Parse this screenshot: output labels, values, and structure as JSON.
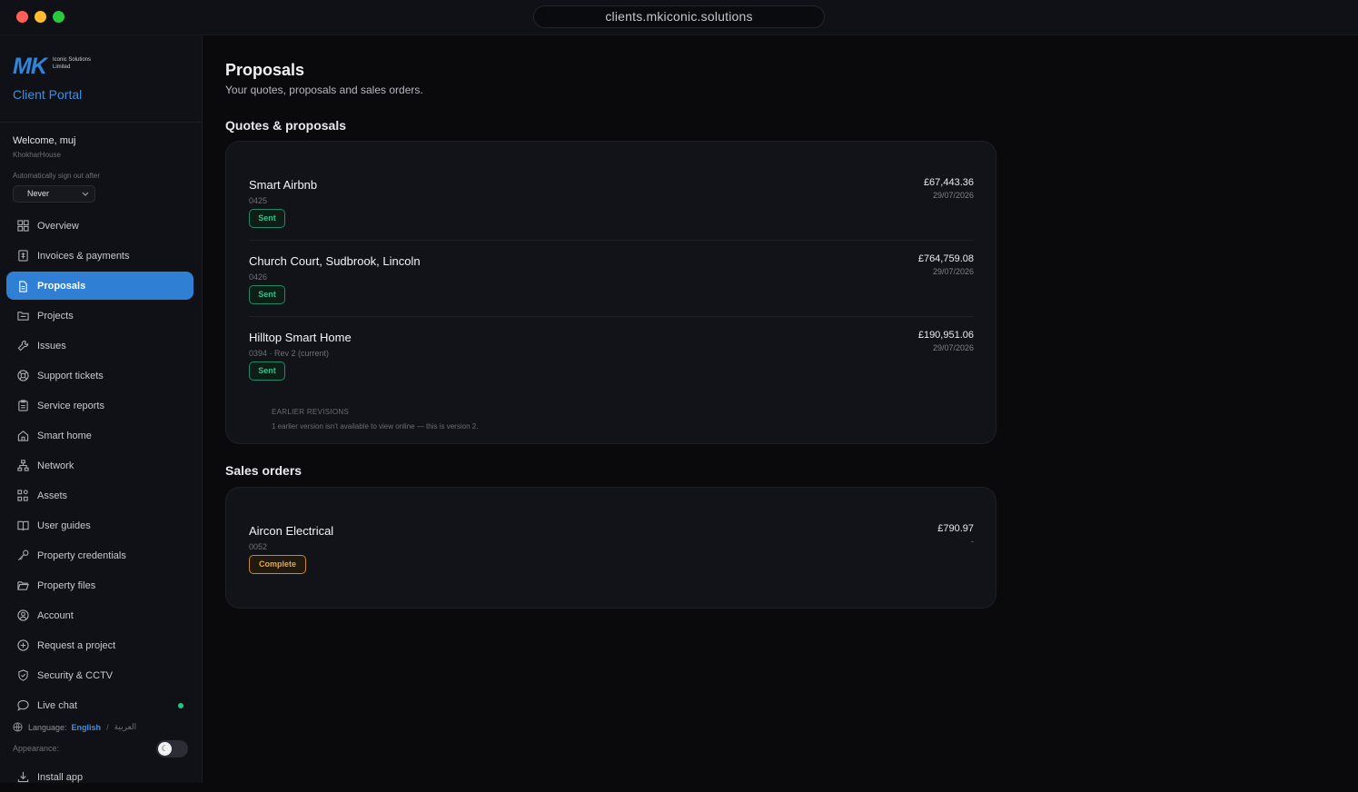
{
  "browser": {
    "url": "clients.mkiconic.solutions"
  },
  "brand": {
    "logo_text": "MK",
    "logo_subtext": "Iconic Solutions Limited",
    "portal_label": "Client Portal"
  },
  "user": {
    "welcome": "Welcome, muj",
    "company": "KhokharHouse"
  },
  "signout": {
    "label": "Automatically sign out after",
    "value": "Never"
  },
  "nav": {
    "items": [
      {
        "label": "Overview",
        "icon": "grid-icon"
      },
      {
        "label": "Invoices & payments",
        "icon": "receipt-icon"
      },
      {
        "label": "Proposals",
        "icon": "document-icon",
        "active": true
      },
      {
        "label": "Projects",
        "icon": "folder-icon"
      },
      {
        "label": "Issues",
        "icon": "wrench-icon"
      },
      {
        "label": "Support tickets",
        "icon": "lifebuoy-icon"
      },
      {
        "label": "Service reports",
        "icon": "clipboard-icon"
      },
      {
        "label": "Smart home",
        "icon": "home-icon"
      },
      {
        "label": "Network",
        "icon": "network-icon"
      },
      {
        "label": "Assets",
        "icon": "assets-icon"
      },
      {
        "label": "User guides",
        "icon": "book-icon"
      },
      {
        "label": "Property credentials",
        "icon": "key-icon"
      },
      {
        "label": "Property files",
        "icon": "folder-open-icon"
      },
      {
        "label": "Account",
        "icon": "user-circle-icon"
      },
      {
        "label": "Request a project",
        "icon": "plus-circle-icon"
      },
      {
        "label": "Security & CCTV",
        "icon": "shield-icon"
      },
      {
        "label": "Live chat",
        "icon": "chat-icon"
      }
    ],
    "install_label": "Install app"
  },
  "language": {
    "label": "Language:",
    "current": "English",
    "alternate": "العربية"
  },
  "appearance": {
    "label": "Appearance:"
  },
  "colors": {
    "accent": "#2f7fd5",
    "sent": "#2cc48c",
    "complete": "#e8a540",
    "online": "#23c48a"
  },
  "page": {
    "title": "Proposals",
    "subtitle": "Your quotes, proposals and sales orders."
  },
  "quotes": {
    "section_title": "Quotes & proposals",
    "items": [
      {
        "title": "Smart Airbnb",
        "ref": "0425",
        "status": "Sent",
        "amount": "£67,443.36",
        "date": "29/07/2026"
      },
      {
        "title": "Church Court, Sudbrook, Lincoln",
        "ref": "0426",
        "status": "Sent",
        "amount": "£764,759.08",
        "date": "29/07/2026"
      },
      {
        "title": "Hilltop Smart Home",
        "ref": "0394 · Rev 2 (current)",
        "status": "Sent",
        "amount": "£190,951.06",
        "date": "29/07/2026",
        "revisions_label": "EARLIER REVISIONS",
        "revisions_note": "1 earlier version isn't available to view online — this is version 2."
      }
    ]
  },
  "sales_orders": {
    "section_title": "Sales orders",
    "items": [
      {
        "title": "Aircon Electrical",
        "ref": "0052",
        "status": "Complete",
        "amount": "£790.97",
        "date": "-"
      }
    ]
  }
}
